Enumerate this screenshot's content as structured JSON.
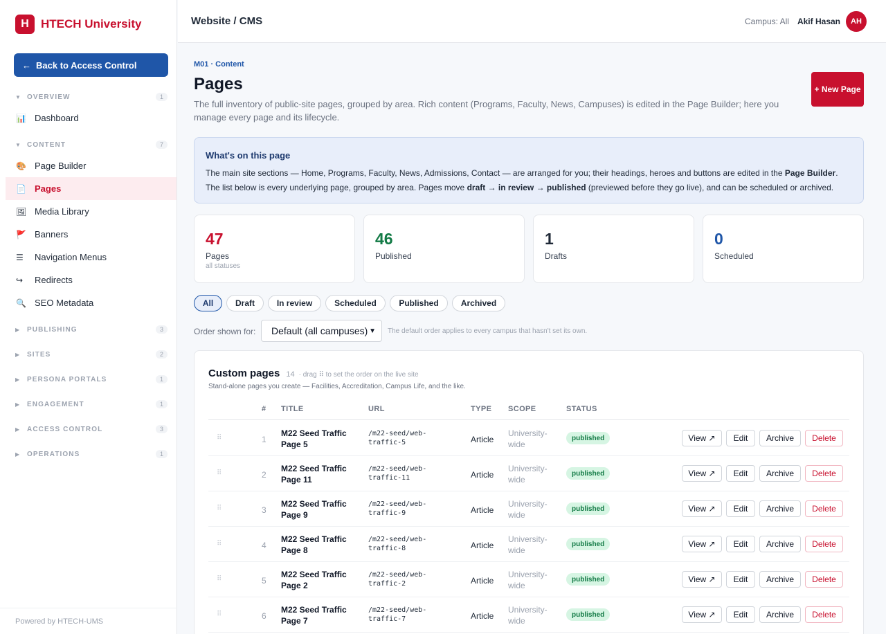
{
  "brand": {
    "logo_letter": "H",
    "name": "HTECH University"
  },
  "sidebar": {
    "back_label": "Back to Access Control",
    "back_arrow": "←",
    "sections": [
      {
        "label": "OVERVIEW",
        "count": "1",
        "expanded": true
      },
      {
        "label": "CONTENT",
        "count": "7",
        "expanded": true
      },
      {
        "label": "PUBLISHING",
        "count": "3",
        "expanded": false
      },
      {
        "label": "SITES",
        "count": "2",
        "expanded": false
      },
      {
        "label": "PERSONA PORTALS",
        "count": "1",
        "expanded": false
      },
      {
        "label": "ENGAGEMENT",
        "count": "1",
        "expanded": false
      },
      {
        "label": "ACCESS CONTROL",
        "count": "3",
        "expanded": false
      },
      {
        "label": "OPERATIONS",
        "count": "1",
        "expanded": false
      }
    ],
    "items": [
      {
        "label": "Dashboard",
        "icon": "bar-chart-icon",
        "glyph": "📊"
      },
      {
        "label": "Page Builder",
        "icon": "palette-icon",
        "glyph": "🎨"
      },
      {
        "label": "Pages",
        "icon": "document-icon",
        "glyph": "📄",
        "active": true
      },
      {
        "label": "Media Library",
        "icon": "image-icon",
        "glyph": "🖼"
      },
      {
        "label": "Banners",
        "icon": "banner-icon",
        "glyph": "🚩"
      },
      {
        "label": "Navigation Menus",
        "icon": "menu-icon",
        "glyph": "☰"
      },
      {
        "label": "Redirects",
        "icon": "redirect-icon",
        "glyph": "↪"
      },
      {
        "label": "SEO Metadata",
        "icon": "magnifier-icon",
        "glyph": "🔍"
      }
    ],
    "footer": "Powered by HTECH-UMS"
  },
  "topbar": {
    "breadcrumb": "Website / CMS",
    "campus": "Campus: All",
    "user": "Akif Hasan",
    "avatar_initials": "AH"
  },
  "page": {
    "kicker": "M01 · Content",
    "title": "Pages",
    "subtitle": "The full inventory of public-site pages, grouped by area. Rich content (Programs, Faculty, News, Campuses) is edited in the Page Builder; here you manage every page and its lifecycle.",
    "new_button": "+ New Page"
  },
  "info": {
    "title": "What's on this page",
    "p1": "The main site sections — Home, Programs, Faculty, News, Admissions, Contact — are arranged for you; their headings, heroes and buttons are edited in the ",
    "p1_bold": "Page Builder",
    "p2": ". The list below is every underlying page, grouped by area. Pages move ",
    "p2_bold": "draft → in review → published",
    "p3": " (previewed before they go live), and can be scheduled or archived."
  },
  "stats": [
    {
      "value": "47",
      "label": "Pages",
      "sub": "all statuses",
      "color": "#c8102e"
    },
    {
      "value": "46",
      "label": "Published",
      "sub": "",
      "color": "#127a45"
    },
    {
      "value": "1",
      "label": "Drafts",
      "sub": "",
      "color": "#1f2937"
    },
    {
      "value": "0",
      "label": "Scheduled",
      "sub": "",
      "color": "#1f56a8"
    }
  ],
  "filters": [
    "All",
    "Draft",
    "In review",
    "Scheduled",
    "Published",
    "Archived"
  ],
  "order": {
    "label": "Order shown for:",
    "value": "Default (all campuses)",
    "hint": "The default order applies to every campus that hasn't set its own."
  },
  "custom_pages": {
    "title": "Custom pages",
    "count": "14",
    "hint": "· drag ⠿ to set the order on the live site",
    "desc": "Stand-alone pages you create — Facilities, Accreditation, Campus Life, and the like.",
    "columns": {
      "num": "#",
      "title": "TITLE",
      "url": "URL",
      "type": "TYPE",
      "scope": "SCOPE",
      "status": "STATUS"
    },
    "actions": {
      "view": "View ↗",
      "edit": "Edit",
      "archive": "Archive",
      "delete": "Delete"
    },
    "rows": [
      {
        "n": "1",
        "title": "M22 Seed Traffic Page 5",
        "url": "/m22-seed/web-traffic-5",
        "type": "Article",
        "scope": "University-wide",
        "status": "published"
      },
      {
        "n": "2",
        "title": "M22 Seed Traffic Page 11",
        "url": "/m22-seed/web-traffic-11",
        "type": "Article",
        "scope": "University-wide",
        "status": "published"
      },
      {
        "n": "3",
        "title": "M22 Seed Traffic Page 9",
        "url": "/m22-seed/web-traffic-9",
        "type": "Article",
        "scope": "University-wide",
        "status": "published"
      },
      {
        "n": "4",
        "title": "M22 Seed Traffic Page 8",
        "url": "/m22-seed/web-traffic-8",
        "type": "Article",
        "scope": "University-wide",
        "status": "published"
      },
      {
        "n": "5",
        "title": "M22 Seed Traffic Page 2",
        "url": "/m22-seed/web-traffic-2",
        "type": "Article",
        "scope": "University-wide",
        "status": "published"
      },
      {
        "n": "6",
        "title": "M22 Seed Traffic Page 7",
        "url": "/m22-seed/web-traffic-7",
        "type": "Article",
        "scope": "University-wide",
        "status": "published"
      }
    ]
  }
}
